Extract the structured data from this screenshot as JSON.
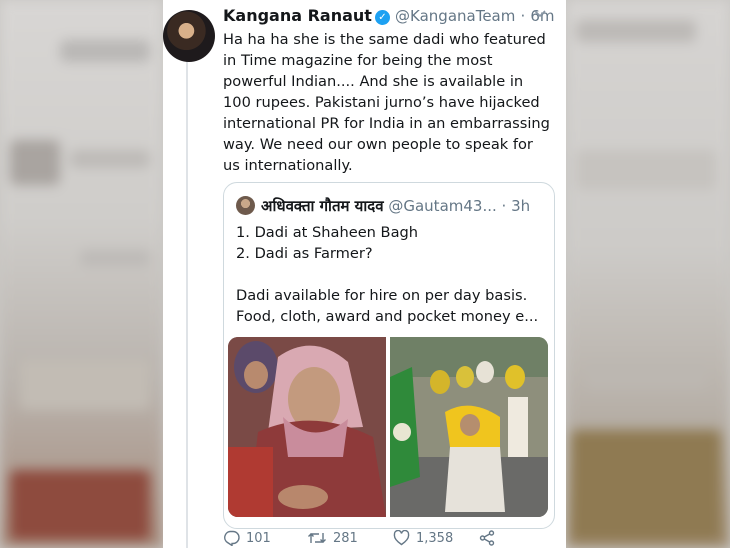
{
  "tweet": {
    "author_name": "Kangana Ranaut",
    "author_handle": "@KanganaTeam",
    "separator": "·",
    "time": "6m",
    "text": "Ha ha ha she is the same dadi who featured in Time magazine for being the most powerful Indian.... And she is available in 100 rupees. Pakistani jurno’s have hijacked international PR for India in an embarrassing way. We need our own people to speak for us internationally."
  },
  "quoted_tweet": {
    "author_name": "अधिवक्ता गौतम यादव",
    "author_handle": "@Gautam43...",
    "separator": "·",
    "time": "3h",
    "text": "1. Dadi at Shaheen Bagh\n2. Dadi as Farmer?\n\nDadi available for hire on per day basis. Food, cloth, award and pocket money e..."
  },
  "actions": {
    "replies": "101",
    "retweets": "281",
    "likes": "1,358"
  },
  "icons": {
    "verified": "verified-badge-icon",
    "menu": "chevron-down-icon",
    "reply": "reply-icon",
    "retweet": "retweet-icon",
    "like": "heart-icon",
    "share": "share-icon"
  },
  "colors": {
    "verified": "#1da1f2",
    "secondary_text": "#657786",
    "primary_text": "#14171a"
  }
}
